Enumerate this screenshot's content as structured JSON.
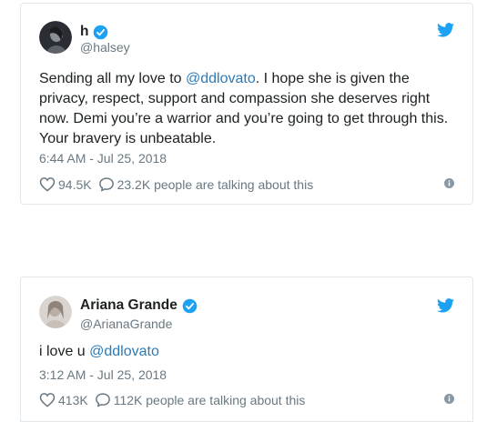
{
  "colors": {
    "twitter_blue": "#1da1f2",
    "mention_link": "#2b7bb9",
    "muted_text": "#697882",
    "border": "#e1e8ed"
  },
  "tweets": [
    {
      "display_name": "h",
      "handle": "@halsey",
      "verified": true,
      "text_before": "Sending all my love to ",
      "mention": "@ddlovato",
      "text_after": ". I hope she is given the privacy, respect, support and compassion she deserves right now. Demi you’re a warrior and you’re going to get through this. Your bravery is unbeatable.",
      "timestamp": "6:44 AM - Jul 25, 2018",
      "likes": "94.5K",
      "talking": "23.2K people are talking about this",
      "icons": [
        "avatar",
        "verified-badge-icon",
        "twitter-bird-icon",
        "heart-icon",
        "reply-icon",
        "info-icon"
      ]
    },
    {
      "display_name": "Ariana Grande",
      "handle": "@ArianaGrande",
      "verified": true,
      "text_before": "i love u ",
      "mention": "@ddlovato",
      "text_after": "",
      "timestamp": "3:12 AM - Jul 25, 2018",
      "likes": "413K",
      "talking": "112K people are talking about this",
      "icons": [
        "avatar",
        "verified-badge-icon",
        "twitter-bird-icon",
        "heart-icon",
        "reply-icon",
        "info-icon"
      ]
    }
  ]
}
